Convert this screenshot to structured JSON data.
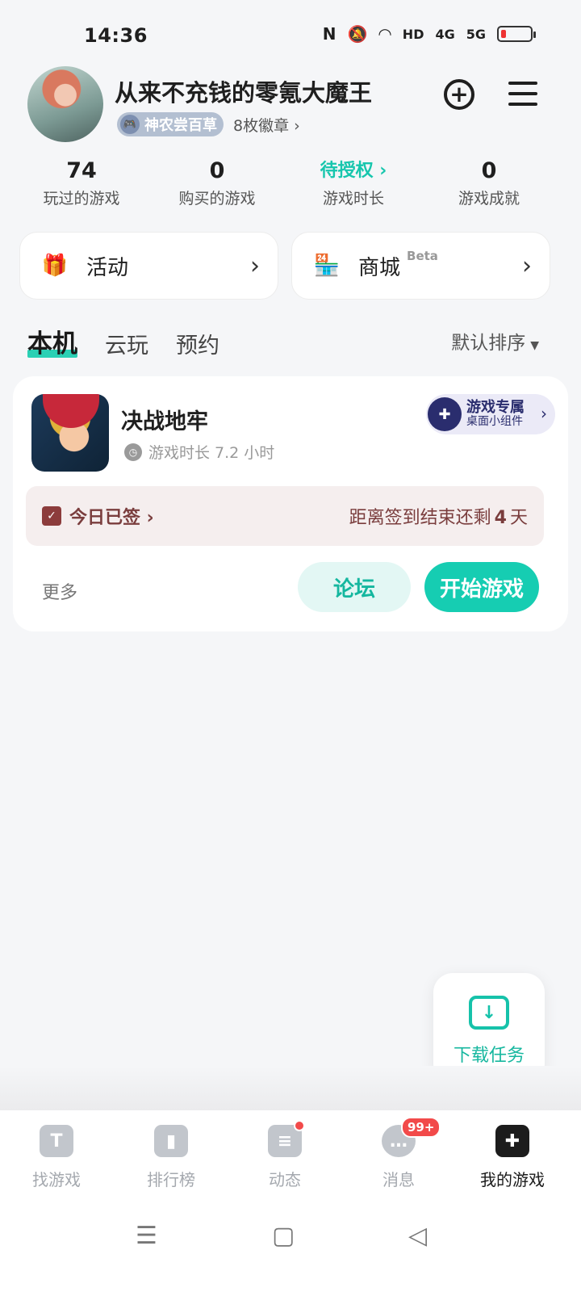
{
  "status_bar": {
    "time": "14:36",
    "icons": [
      "nfc-icon",
      "mute-icon",
      "wifi-icon",
      "hd-icon",
      "4g-signal-icon",
      "5g-signal-icon",
      "battery-low-icon"
    ],
    "labels": {
      "hd": "HD",
      "g4": "4G",
      "g5": "5G"
    }
  },
  "profile": {
    "username": "从来不充钱的零氪大魔王",
    "title_badge": "神农尝百草",
    "badge_count": "8枚徽章 ›"
  },
  "stats": [
    {
      "value": "74",
      "label": "玩过的游戏"
    },
    {
      "value": "0",
      "label": "购买的游戏"
    },
    {
      "value": "待授权 ›",
      "label": "游戏时长"
    },
    {
      "value": "0",
      "label": "游戏成就"
    }
  ],
  "cards": {
    "activity": {
      "label": "活动",
      "icon": "gift-icon"
    },
    "store": {
      "label": "商城",
      "tag": "Beta",
      "icon": "store-icon"
    }
  },
  "tabs": [
    {
      "label": "本机",
      "active": true
    },
    {
      "label": "云玩",
      "active": false
    },
    {
      "label": "预约",
      "active": false
    }
  ],
  "sort": {
    "label": "默认排序",
    "caret": "▼"
  },
  "game": {
    "name": "决战地牢",
    "play_time": "游戏时长 7.2 小时",
    "widget": {
      "title": "游戏专属",
      "subtitle": "桌面小组件"
    },
    "sign_in": {
      "status": "今日已签 ›",
      "remaining_prefix": "距离签到结束还剩",
      "remaining_days": "4",
      "remaining_suffix": "天"
    },
    "more": "更多",
    "forum": "论坛",
    "start": "开始游戏"
  },
  "download": {
    "label": "下载任务"
  },
  "bottom_nav": [
    {
      "label": "找游戏",
      "icon": "find-game-icon",
      "active": false
    },
    {
      "label": "排行榜",
      "icon": "ranking-icon",
      "active": false
    },
    {
      "label": "动态",
      "icon": "feed-icon",
      "active": false,
      "dot": true
    },
    {
      "label": "消息",
      "icon": "message-icon",
      "active": false,
      "count": "99+"
    },
    {
      "label": "我的游戏",
      "icon": "my-games-icon",
      "active": true
    }
  ],
  "colors": {
    "accent": "#16cdb2",
    "accent_text": "#17c6ad",
    "background": "#f5f6f8",
    "sign_bar_bg": "#f5eeee",
    "sign_bar_text": "#7a3d3d",
    "badge_red": "#f24a4a"
  }
}
